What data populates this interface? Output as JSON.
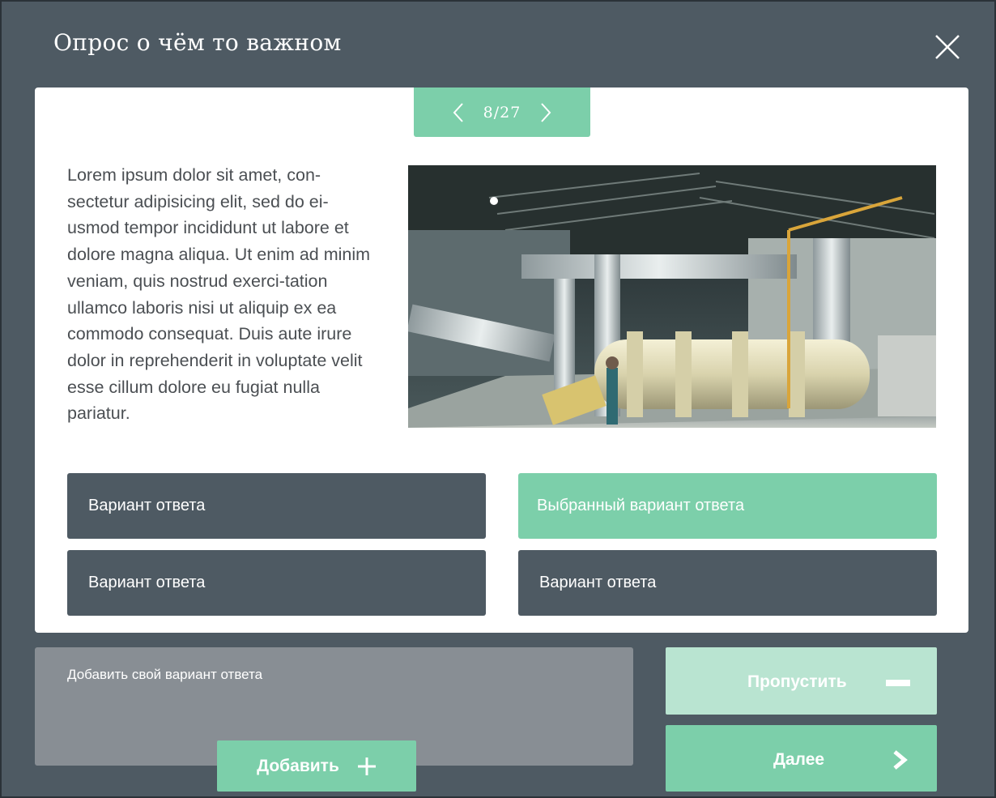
{
  "app": {
    "title": "Опрос о чём то важном",
    "close_icon": "close-icon"
  },
  "pager": {
    "text": "8/27",
    "current": 8,
    "total": 27,
    "prev_icon": "chevron-left-icon",
    "next_icon": "chevron-right-icon"
  },
  "question": {
    "text": "Lorem ipsum dolor sit amet, con-sectetur adipisicing elit, sed do ei-usmod tempor incididunt ut labore et dolore magna aliqua. Ut enim ad minim veniam, quis nostrud exerci-tation ullamco laboris nisi ut aliquip ex ea commodo consequat. Duis aute irure dolor in reprehenderit in voluptate velit esse cillum dolore eu fugiat nulla pariatur.",
    "image": "industrial-hall-photo"
  },
  "answers": [
    {
      "label": "Вариант ответа",
      "selected": false
    },
    {
      "label": "Выбранный вариант ответа",
      "selected": true
    },
    {
      "label": "Вариант ответа",
      "selected": false
    },
    {
      "label": "Вариант ответа",
      "selected": false
    }
  ],
  "custom_answer": {
    "placeholder": "Добавить свой вариант ответа",
    "value": "",
    "add_label": "Добавить",
    "add_icon": "plus-icon"
  },
  "actions": {
    "skip_label": "Пропустить",
    "skip_icon": "minus-icon",
    "next_label": "Далее",
    "next_icon": "chevron-right-icon"
  },
  "colors": {
    "background": "#4e5a63",
    "accent": "#7ccfaa",
    "accent_light": "#b9e4d1",
    "card": "#ffffff",
    "input_bg": "#888e94"
  }
}
